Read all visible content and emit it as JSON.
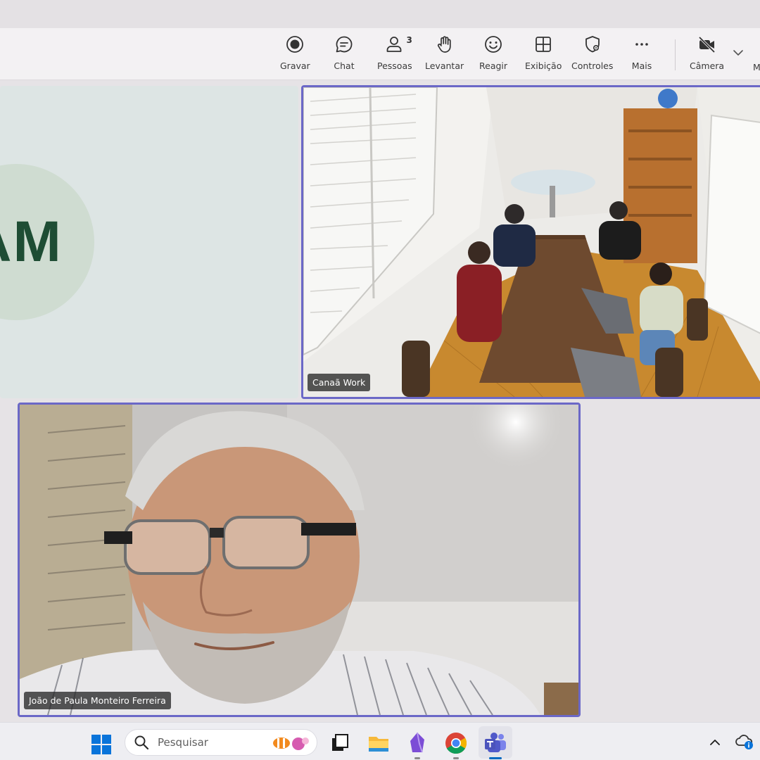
{
  "toolbar": {
    "buttons": [
      {
        "label": "Gravar",
        "icon": "record-icon"
      },
      {
        "label": "Chat",
        "icon": "chat-icon"
      },
      {
        "label": "Pessoas",
        "icon": "people-icon",
        "count": "3"
      },
      {
        "label": "Levantar",
        "icon": "raise-hand-icon"
      },
      {
        "label": "Reagir",
        "icon": "smiley-icon"
      },
      {
        "label": "Exibição",
        "icon": "grid-view-icon"
      },
      {
        "label": "Controles",
        "icon": "shield-gear-icon"
      },
      {
        "label": "Mais",
        "icon": "more-dots-icon"
      },
      {
        "label": "Câmera",
        "icon": "camera-off-icon"
      }
    ],
    "truncated_label": "M"
  },
  "participants": {
    "avatar_initials": "AM",
    "tile1_name": "Canaã Work",
    "tile2_name": "João de Paula Monteiro Ferreira"
  },
  "taskbar": {
    "search_placeholder": "Pesquisar",
    "apps": [
      "windows-start-icon",
      "task-view-icon",
      "file-explorer-icon",
      "obsidian-icon",
      "chrome-icon",
      "teams-icon"
    ]
  },
  "colors": {
    "active_border": "#6b68c7",
    "avatar_bg": "#cfdcd1",
    "avatar_text": "#1e4d34"
  }
}
